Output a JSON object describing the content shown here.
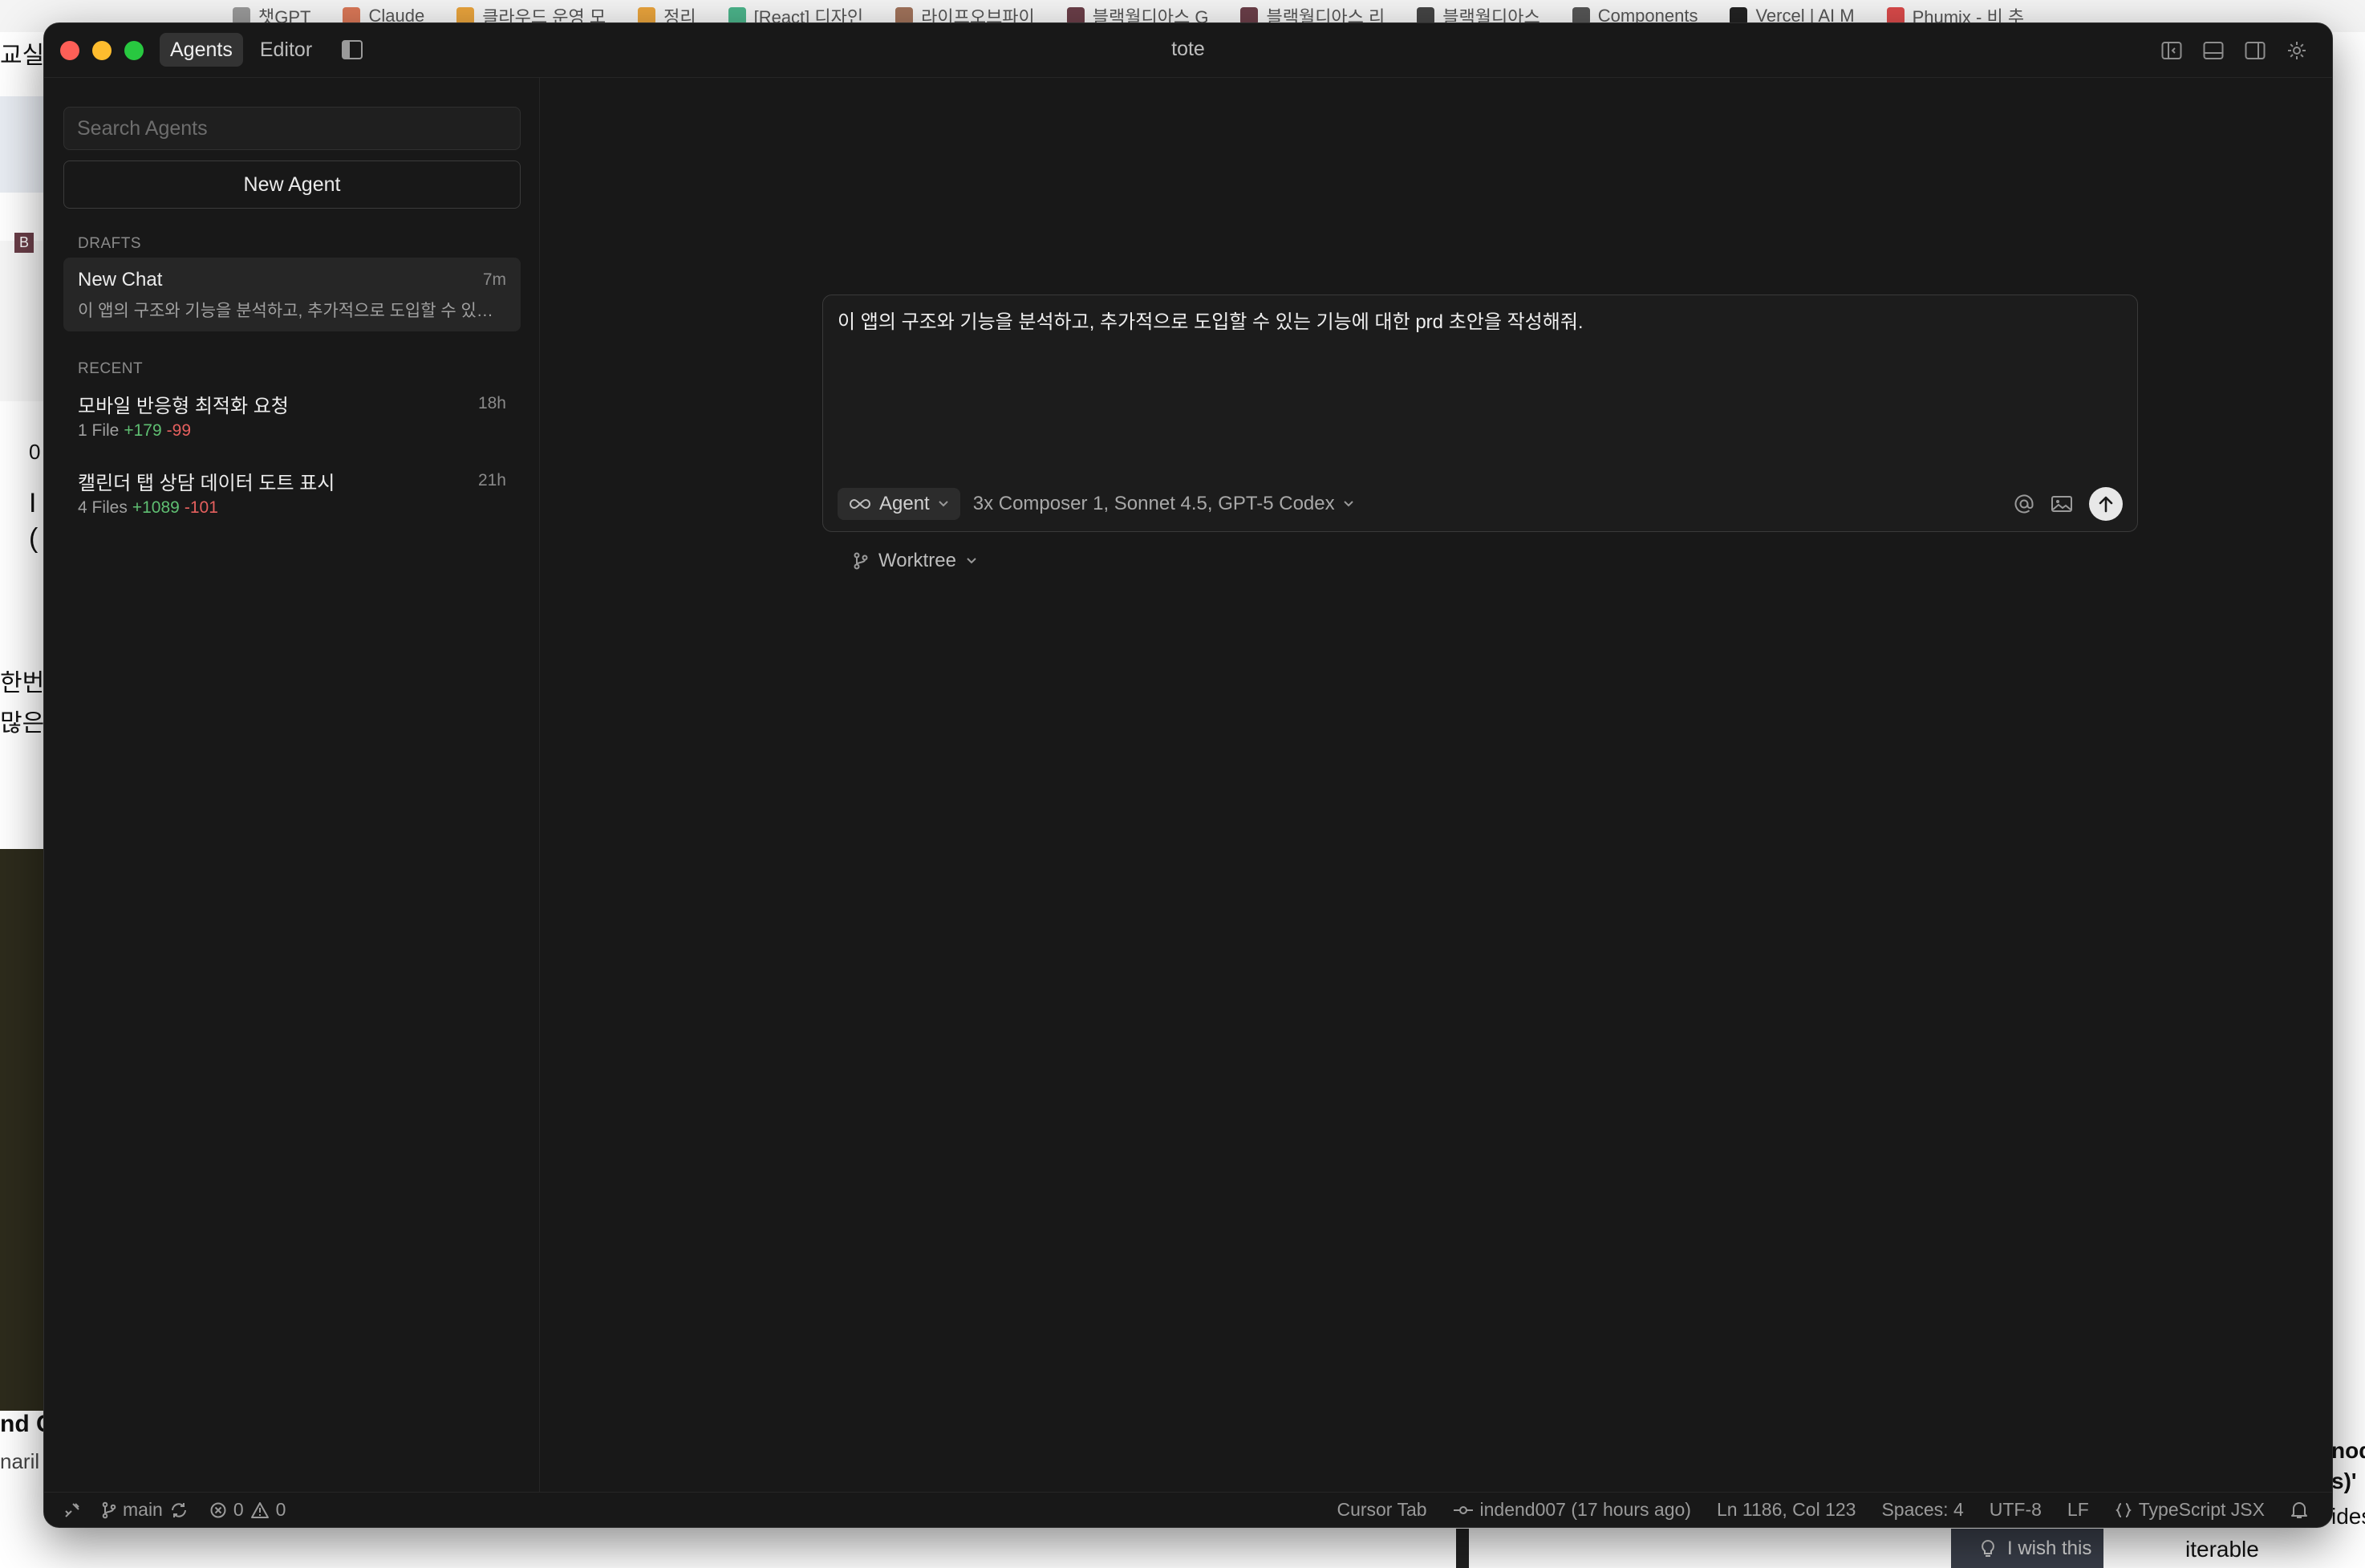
{
  "background": {
    "bookmarks": [
      "챗GPT",
      "Claude",
      "클라우드 운영 모",
      "정리",
      "[React] 디자인",
      "라이프오브파이",
      "블랙월디아스 G",
      "블랙월디아스 리",
      "블랙월디아스",
      "Components",
      "Vercel | AI M",
      "Phumix - 비 추"
    ],
    "left_fragments": [
      "교실",
      "B",
      "0",
      "I",
      "(",
      "한번의",
      "많은",
      "nd C",
      "naril"
    ],
    "right_fragments": [
      "nod",
      "s)'",
      "ides."
    ],
    "wish_text": "I wish this",
    "iterable_text": "iterable"
  },
  "window": {
    "title": "tote",
    "tabs": [
      {
        "label": "Agents",
        "active": true
      },
      {
        "label": "Editor",
        "active": false
      }
    ]
  },
  "sidebar": {
    "search_placeholder": "Search Agents",
    "new_agent_label": "New Agent",
    "drafts_label": "DRAFTS",
    "drafts": [
      {
        "title": "New Chat",
        "time": "7m",
        "preview": "이 앱의 구조와 기능을 분석하고, 추가적으로 도입할 수 있는 기능에 대한 prd 초안을 작성해줘."
      }
    ],
    "recent_label": "RECENT",
    "recent": [
      {
        "title": "모바일 반응형 최적화 요청",
        "time": "18h",
        "files": "1 File",
        "additions": "+179",
        "deletions": "-99"
      },
      {
        "title": "캘린더 탭 상담 데이터 도트 표시",
        "time": "21h",
        "files": "4 Files",
        "additions": "+1089",
        "deletions": "-101"
      }
    ]
  },
  "composer": {
    "text": "이 앱의 구조와 기능을 분석하고, 추가적으로 도입할 수 있는 기능에 대한 prd 초안을 작성해줘.",
    "mode_label": "Agent",
    "models_label": "3x Composer 1, Sonnet 4.5, GPT-5 Codex",
    "worktree_label": "Worktree"
  },
  "statusbar": {
    "branch": "main",
    "errors": "0",
    "warnings": "0",
    "cursor_tab": "Cursor Tab",
    "blame": "indend007 (17 hours ago)",
    "position": "Ln 1186, Col 123",
    "spaces": "Spaces: 4",
    "encoding": "UTF-8",
    "eol": "LF",
    "language": "TypeScript JSX"
  }
}
